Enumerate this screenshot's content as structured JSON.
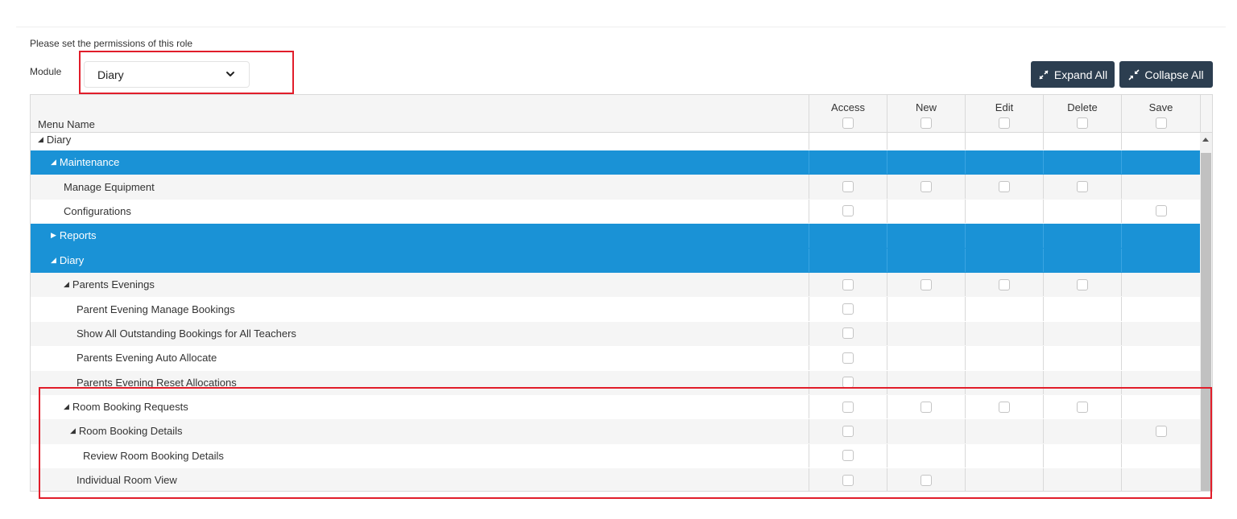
{
  "instruction": "Please set the permissions of this role",
  "module": {
    "label": "Module",
    "selected": "Diary"
  },
  "buttons": {
    "expand_all": "Expand All",
    "collapse_all": "Collapse All"
  },
  "grid": {
    "menu_name_header": "Menu Name",
    "columns": [
      "Access",
      "New",
      "Edit",
      "Delete",
      "Save"
    ],
    "rows": [
      {
        "name": "Diary",
        "arrow": "◢",
        "level": 0,
        "type": "plain",
        "checks": [
          false,
          false,
          false,
          false,
          false
        ]
      },
      {
        "name": "Maintenance",
        "arrow": "◢",
        "level": 1,
        "type": "group",
        "checks": [
          false,
          false,
          false,
          false,
          false
        ]
      },
      {
        "name": "Manage Equipment",
        "arrow": "",
        "level": 2,
        "type": "plain",
        "checks": [
          true,
          true,
          true,
          true,
          false
        ]
      },
      {
        "name": "Configurations",
        "arrow": "",
        "level": 2,
        "type": "plain",
        "checks": [
          true,
          false,
          false,
          false,
          true
        ]
      },
      {
        "name": "Reports",
        "arrow": "▶",
        "level": 1,
        "type": "group",
        "checks": [
          false,
          false,
          false,
          false,
          false
        ]
      },
      {
        "name": "Diary",
        "arrow": "◢",
        "level": 1,
        "type": "group",
        "checks": [
          false,
          false,
          false,
          false,
          false
        ]
      },
      {
        "name": "Parents Evenings",
        "arrow": "◢",
        "level": 2,
        "type": "plain",
        "checks": [
          true,
          true,
          true,
          true,
          false
        ]
      },
      {
        "name": "Parent Evening Manage Bookings",
        "arrow": "",
        "level": 3,
        "type": "plain",
        "checks": [
          true,
          false,
          false,
          false,
          false
        ]
      },
      {
        "name": "Show All Outstanding Bookings for All Teachers",
        "arrow": "",
        "level": 3,
        "type": "plain",
        "checks": [
          true,
          false,
          false,
          false,
          false
        ]
      },
      {
        "name": "Parents Evening Auto Allocate",
        "arrow": "",
        "level": 3,
        "type": "plain",
        "checks": [
          true,
          false,
          false,
          false,
          false
        ]
      },
      {
        "name": "Parents Evening Reset Allocations",
        "arrow": "",
        "level": 3,
        "type": "plain",
        "checks": [
          true,
          false,
          false,
          false,
          false
        ]
      },
      {
        "name": "Room Booking Requests",
        "arrow": "◢",
        "level": 2,
        "type": "plain",
        "checks": [
          true,
          true,
          true,
          true,
          false
        ]
      },
      {
        "name": "Room Booking Details",
        "arrow": "◢",
        "level": 2.5,
        "type": "plain",
        "checks": [
          true,
          false,
          false,
          false,
          true
        ]
      },
      {
        "name": "Review Room Booking Details",
        "arrow": "",
        "level": 3.5,
        "type": "plain",
        "checks": [
          true,
          false,
          false,
          false,
          false
        ]
      },
      {
        "name": "Individual Room View",
        "arrow": "",
        "level": 3,
        "type": "plain",
        "checks": [
          true,
          true,
          false,
          false,
          false
        ]
      }
    ]
  }
}
